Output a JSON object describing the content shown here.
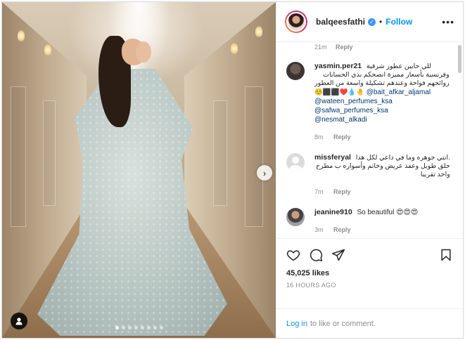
{
  "post": {
    "username": "balqeesfathi",
    "follow_label": "Follow",
    "bullet": "•",
    "more": "•••"
  },
  "top_meta": {
    "time": "21m",
    "reply": "Reply"
  },
  "comments": [
    {
      "username": "yasmin.per21",
      "text_lines": [
        "للي حابين عطور شرقية",
        "وفرنسية بأسعار مميزة انصحكم بذي الحسابات",
        "روائحهم فواحة وعندهم تشكيلة واسعة من العطور",
        "☺️⬛️⬛️❤️💧🤚"
      ],
      "mentions": [
        "@bait_afkar_aljamal",
        "@wateen_perfumes_ksa",
        "@safwa_perfumes_ksa",
        "@nesmat_alkadi"
      ],
      "time": "8m",
      "reply": "Reply"
    },
    {
      "username": "missferyal",
      "text_lines": [
        "انتي جوهره وما في داعي لكل هذا.",
        "حلق طويل وعقد عريض وخاتم وأسواره ب مطرح",
        "واحد تقريبا"
      ],
      "time": "7m",
      "reply": "Reply"
    },
    {
      "username": "jeanine910",
      "text": "So beautiful 😍😍😍",
      "time": "3m",
      "reply": "Reply"
    }
  ],
  "likes": "45,025 likes",
  "posted_ago": "16 HOURS AGO",
  "login": {
    "link": "Log in",
    "rest": "to like or comment."
  },
  "carousel": {
    "total": 8,
    "active": 1
  },
  "colors": {
    "accent": "#0095f6",
    "verified": "#3897f0"
  }
}
